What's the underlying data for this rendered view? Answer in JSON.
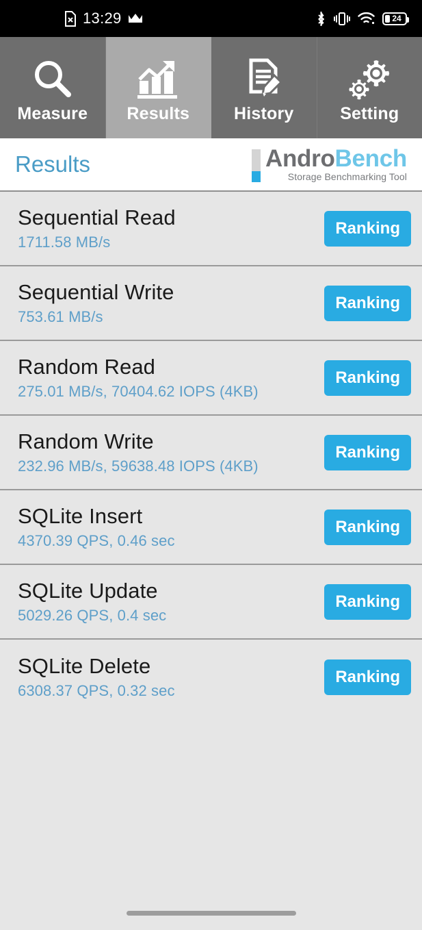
{
  "statusbar": {
    "time": "13:29",
    "left_icons": [
      {
        "name": "no-sim-card-icon",
        "glyph": "sim-x"
      },
      {
        "name": "crown-icon",
        "glyph": "crown"
      }
    ],
    "right_icons": [
      {
        "name": "bluetooth-icon",
        "glyph": "bluetooth"
      },
      {
        "name": "vibrate-mode-icon",
        "glyph": "vibrate"
      },
      {
        "name": "wifi-icon",
        "glyph": "wifi"
      }
    ],
    "battery": {
      "level": "24",
      "label": "24"
    }
  },
  "tabs": [
    {
      "label": "Measure",
      "icon": "magnifier-icon",
      "active": false
    },
    {
      "label": "Results",
      "icon": "bar-chart-trend-icon",
      "active": true
    },
    {
      "label": "History",
      "icon": "document-pencil-icon",
      "active": false
    },
    {
      "label": "Setting",
      "icon": "gears-icon",
      "active": false
    }
  ],
  "header": {
    "title": "Results",
    "logo": {
      "word_a": "Andro",
      "word_b": "Bench",
      "tagline": "Storage Benchmarking Tool"
    }
  },
  "results": [
    {
      "title": "Sequential Read",
      "value": "1711.58 MB/s",
      "button": "Ranking"
    },
    {
      "title": "Sequential Write",
      "value": "753.61 MB/s",
      "button": "Ranking"
    },
    {
      "title": "Random Read",
      "value": "275.01 MB/s, 70404.62 IOPS (4KB)",
      "button": "Ranking"
    },
    {
      "title": "Random Write",
      "value": "232.96 MB/s, 59638.48 IOPS (4KB)",
      "button": "Ranking"
    },
    {
      "title": "SQLite Insert",
      "value": "4370.39 QPS, 0.46 sec",
      "button": "Ranking"
    },
    {
      "title": "SQLite Update",
      "value": "5029.26 QPS, 0.4 sec",
      "button": "Ranking"
    },
    {
      "title": "SQLite Delete",
      "value": "6308.37 QPS, 0.32 sec",
      "button": "Ranking"
    }
  ],
  "colors": {
    "accent_blue": "#29abe2",
    "value_blue": "#5e9fc9",
    "title_blue": "#4a9cc6",
    "tab_inactive": "#6e6e6e",
    "tab_active": "#aaaaaa",
    "list_bg": "#e6e6e6",
    "statusbar_bg": "#000000"
  }
}
